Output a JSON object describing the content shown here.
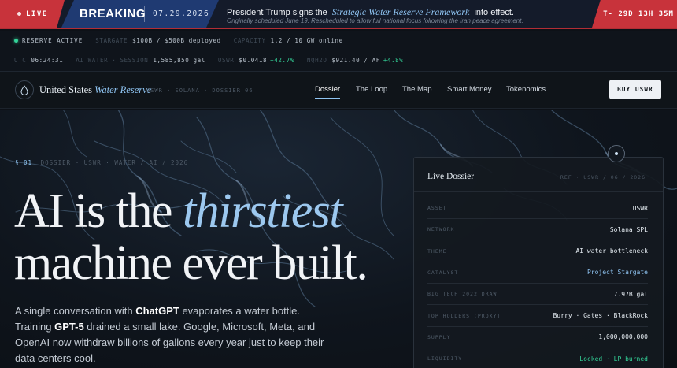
{
  "banner": {
    "live": "LIVE",
    "breaking": "BREAKING",
    "date": "07.29.2026",
    "headline_pre": "President Trump signs the",
    "headline_highlight": "Strategic Water Reserve Framework",
    "headline_post": "into effect.",
    "subline": "Originally scheduled June 19. Rescheduled to allow full national focus following the Iran peace agreement.",
    "countdown": "T- 29D 13H 35M"
  },
  "ticker": {
    "row1": [
      {
        "key": "",
        "value": "RESERVE ACTIVE",
        "status": true
      },
      {
        "key": "STARGATE",
        "value": "$100B / $500B deployed"
      },
      {
        "key": "CAPACITY",
        "value": "1.2 / 10 GW online"
      }
    ],
    "row2": [
      {
        "key": "UTC",
        "value": "06:24:31"
      },
      {
        "key": "AI WATER · SESSION",
        "value": "1,585,850 gal"
      },
      {
        "key": "USWR",
        "value": "$0.0418",
        "delta": "+42.7%"
      },
      {
        "key": "NQH2O",
        "value": "$921.40 / AF",
        "delta": "+4.8%"
      }
    ]
  },
  "nav": {
    "brand_main": "United States",
    "brand_italic": "Water Reserve",
    "brand_sub": "USWR · SOLANA · DOSSIER 06",
    "links": [
      "Dossier",
      "The Loop",
      "The Map",
      "Smart Money",
      "Tokenomics"
    ],
    "cta": "BUY USWR"
  },
  "hero": {
    "tag_num": "§ 01",
    "tag_text": "DOSSIER · USWR · WATER / AI / 2026",
    "headline_l1a": "AI is the ",
    "headline_l1b": "thirstiest",
    "headline_l2": "machine ever built.",
    "lede_1": "A single conversation with ",
    "lede_b1": "ChatGPT",
    "lede_2": " evaporates a water bottle. Training ",
    "lede_b2": "GPT-5",
    "lede_3": " drained a small lake. Google, Microsoft, Meta, and OpenAI now withdraw billions of gallons every year just to keep their data centers cool."
  },
  "dossier": {
    "title": "Live Dossier",
    "ref": "REF · USWR / 06 / 2026",
    "rows": [
      {
        "key": "ASSET",
        "value": "USWR",
        "style": ""
      },
      {
        "key": "NETWORK",
        "value": "Solana SPL",
        "style": ""
      },
      {
        "key": "THEME",
        "value": "AI water bottleneck",
        "style": ""
      },
      {
        "key": "CATALYST",
        "value": "Project Stargate",
        "style": "accent"
      },
      {
        "key": "BIG TECH 2022 DRAW",
        "value": "7.97B gal",
        "style": ""
      },
      {
        "key": "TOP HOLDERS (PROXY)",
        "value": "Burry · Gates · BlackRock",
        "style": ""
      },
      {
        "key": "SUPPLY",
        "value": "1,000,000,000",
        "style": ""
      },
      {
        "key": "LIQUIDITY",
        "value": "Locked · LP burned",
        "style": "green"
      }
    ]
  },
  "colors": {
    "accent": "#8fc4f2",
    "live_red": "#c8333b",
    "breaking_blue": "#1f3a72",
    "positive": "#34d399"
  }
}
